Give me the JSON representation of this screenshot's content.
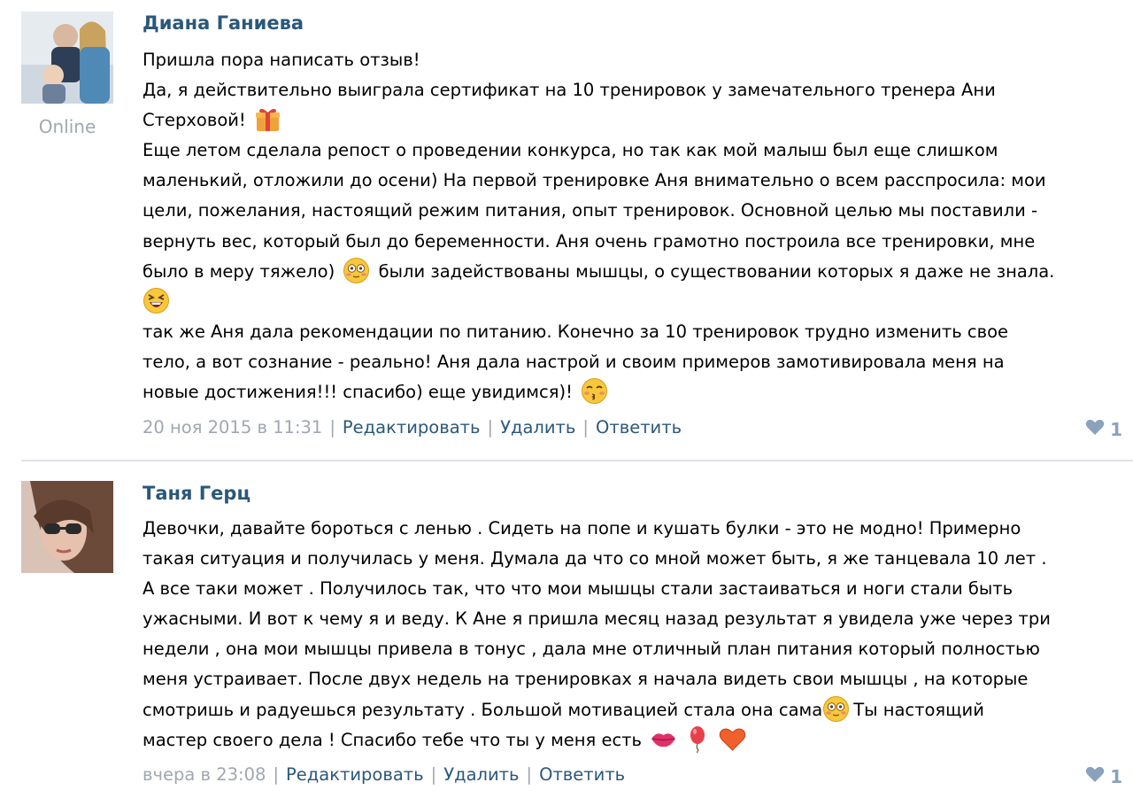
{
  "comments": [
    {
      "author": "Диана Ганиева",
      "status": "Online",
      "lines": [
        [
          "Пришла пора написать отзыв!"
        ],
        [
          "Да, я действительно выиграла сертификат на 10 тренировок у замечательного тренера Ани"
        ],
        [
          "Стерховой!"
        ],
        [
          "Еще летом сделала репост о проведении конкурса, но так как мой малыш был еще слишком"
        ],
        [
          "маленький, отложили до осени) На первой тренировке Аня внимательно о всем расспросила: мои"
        ],
        [
          "цели, пожелания, настоящий режим питания, опыт тренировок. Основной целью мы поставили -"
        ],
        [
          "вернуть вес, который был до беременности. Аня очень грамотно построила все тренировки, мне"
        ],
        [
          "было в меру тяжело)",
          "были задействованы мышцы, о существовании которых я даже не знала."
        ],
        [
          ""
        ],
        [
          "так же Аня дала рекомендации по питанию. Конечно за 10 тренировок трудно изменить свое"
        ],
        [
          "тело, а вот сознание - реально! Аня дала настрой и своим примеров замотивировала меня на"
        ],
        [
          "новые достижения!!! спасибо) еще увидимся)!"
        ]
      ],
      "date": "20 ноя 2015 в 11:31",
      "actions": {
        "edit": "Редактировать",
        "delete": "Удалить",
        "reply": "Ответить"
      },
      "likes": "1",
      "emojis": [
        "gift-emoji",
        "flushed-emoji",
        "laughing-emoji",
        "kiss-emoji"
      ]
    },
    {
      "author": "Таня Герц",
      "lines": [
        [
          "Девочки, давайте бороться с ленью . Сидеть на попе и кушать булки - это не модно! Примерно"
        ],
        [
          "такая ситуация и получилась у меня. Думала да что со мной может быть, я же танцевала 10 лет ."
        ],
        [
          "А все таки может . Получилось так, что что мои мышцы стали застаиваться и ноги стали быть"
        ],
        [
          "ужасными. И вот к чему я и веду. К Ане я пришла месяц назад результат я увидела уже через три"
        ],
        [
          "недели , она мои мышцы привела в тонус , дала мне отличный план питания который полностью"
        ],
        [
          "меня устраивает. После двух недель на тренировках я начала видеть свои мышцы , на которые"
        ],
        [
          "смотришь и радуешься результату . Большой мотивацией стала она сама",
          "Ты настоящий"
        ],
        [
          "мастер своего дела ! Спасибо тебе что ты у меня есть"
        ]
      ],
      "date": "вчера в 23:08",
      "actions": {
        "edit": "Редактировать",
        "delete": "Удалить",
        "reply": "Ответить"
      },
      "likes": "1",
      "emojis": [
        "flushed-emoji",
        "lips-emoji",
        "balloon-emoji",
        "heart-emoji"
      ]
    }
  ],
  "colors": {
    "author": "#2b587a",
    "link": "#2b587a",
    "meta": "#a0a7b0",
    "like": "#8aa2bc",
    "divider": "#dfe3e8"
  }
}
